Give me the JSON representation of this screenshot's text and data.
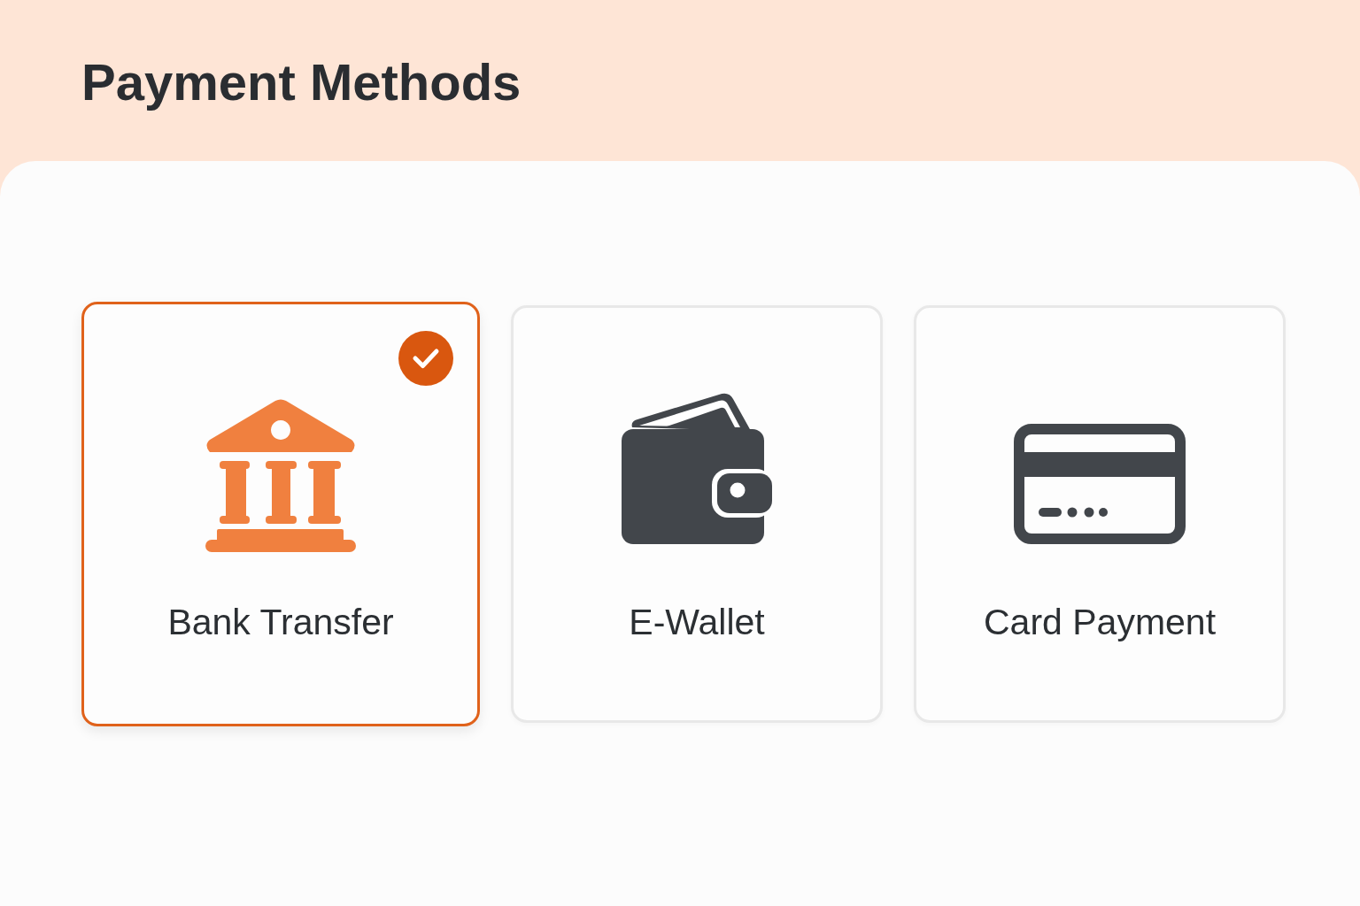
{
  "header": {
    "title": "Payment Methods"
  },
  "methods": [
    {
      "kind": "bank",
      "label": "Bank Transfer",
      "selected": true
    },
    {
      "kind": "wallet",
      "label": "E-Wallet",
      "selected": false
    },
    {
      "kind": "card",
      "label": "Card Payment",
      "selected": false
    }
  ]
}
